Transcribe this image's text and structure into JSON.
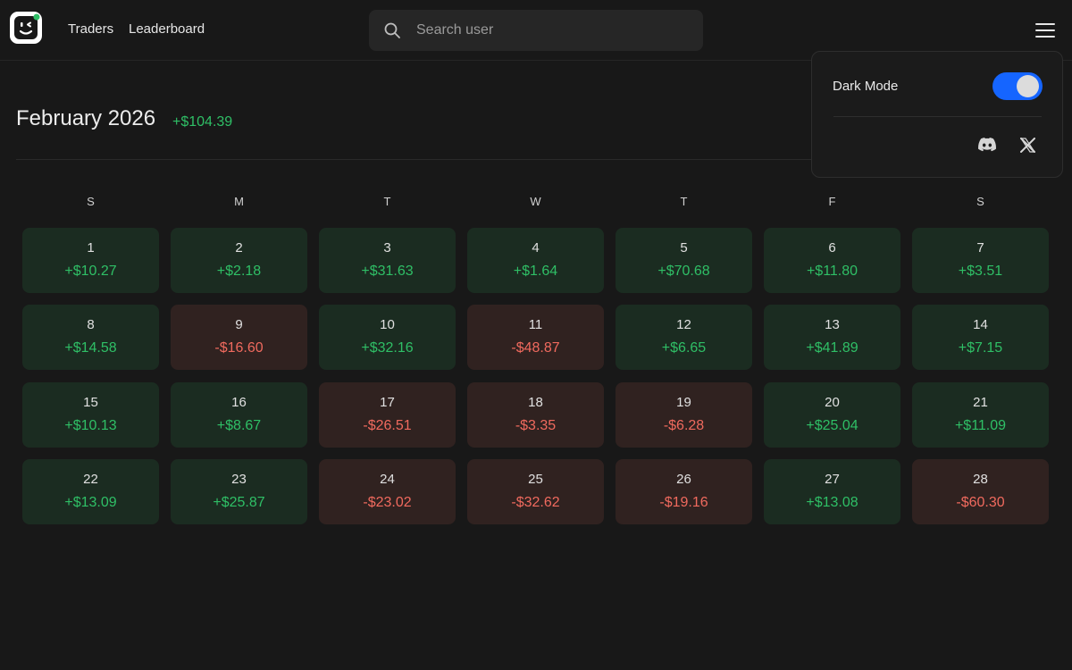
{
  "nav": {
    "logo_icon": "smiley-face-logo-icon",
    "traders_label": "Traders",
    "leaderboard_label": "Leaderboard"
  },
  "search": {
    "placeholder": "Search user",
    "value": ""
  },
  "month": {
    "title": "February 2026",
    "total": "+$104.39"
  },
  "weekdays": [
    "S",
    "M",
    "T",
    "W",
    "T",
    "F",
    "S"
  ],
  "days": [
    {
      "day": "1",
      "pnl": "+$10.27",
      "status": "pos"
    },
    {
      "day": "2",
      "pnl": "+$2.18",
      "status": "pos"
    },
    {
      "day": "3",
      "pnl": "+$31.63",
      "status": "pos"
    },
    {
      "day": "4",
      "pnl": "+$1.64",
      "status": "pos"
    },
    {
      "day": "5",
      "pnl": "+$70.68",
      "status": "pos"
    },
    {
      "day": "6",
      "pnl": "+$11.80",
      "status": "pos"
    },
    {
      "day": "7",
      "pnl": "+$3.51",
      "status": "pos"
    },
    {
      "day": "8",
      "pnl": "+$14.58",
      "status": "pos"
    },
    {
      "day": "9",
      "pnl": "-$16.60",
      "status": "neg"
    },
    {
      "day": "10",
      "pnl": "+$32.16",
      "status": "pos"
    },
    {
      "day": "11",
      "pnl": "-$48.87",
      "status": "neg"
    },
    {
      "day": "12",
      "pnl": "+$6.65",
      "status": "pos"
    },
    {
      "day": "13",
      "pnl": "+$41.89",
      "status": "pos"
    },
    {
      "day": "14",
      "pnl": "+$7.15",
      "status": "pos"
    },
    {
      "day": "15",
      "pnl": "+$10.13",
      "status": "pos"
    },
    {
      "day": "16",
      "pnl": "+$8.67",
      "status": "pos"
    },
    {
      "day": "17",
      "pnl": "-$26.51",
      "status": "neg"
    },
    {
      "day": "18",
      "pnl": "-$3.35",
      "status": "neg"
    },
    {
      "day": "19",
      "pnl": "-$6.28",
      "status": "neg"
    },
    {
      "day": "20",
      "pnl": "+$25.04",
      "status": "pos"
    },
    {
      "day": "21",
      "pnl": "+$11.09",
      "status": "pos"
    },
    {
      "day": "22",
      "pnl": "+$13.09",
      "status": "pos"
    },
    {
      "day": "23",
      "pnl": "+$25.87",
      "status": "pos"
    },
    {
      "day": "24",
      "pnl": "-$23.02",
      "status": "neg"
    },
    {
      "day": "25",
      "pnl": "-$32.62",
      "status": "neg"
    },
    {
      "day": "26",
      "pnl": "-$19.16",
      "status": "neg"
    },
    {
      "day": "27",
      "pnl": "+$13.08",
      "status": "pos"
    },
    {
      "day": "28",
      "pnl": "-$60.30",
      "status": "neg"
    }
  ],
  "dropdown": {
    "dark_mode_label": "Dark Mode",
    "dark_mode_on": true,
    "icons": [
      "discord-icon",
      "x-icon"
    ]
  },
  "colors": {
    "background": "#181818",
    "positive": "#2fbf66",
    "negative": "#f06a5e",
    "positive_cell": "#1b2c21",
    "negative_cell": "#302220",
    "toggle_accent": "#1565ff"
  }
}
